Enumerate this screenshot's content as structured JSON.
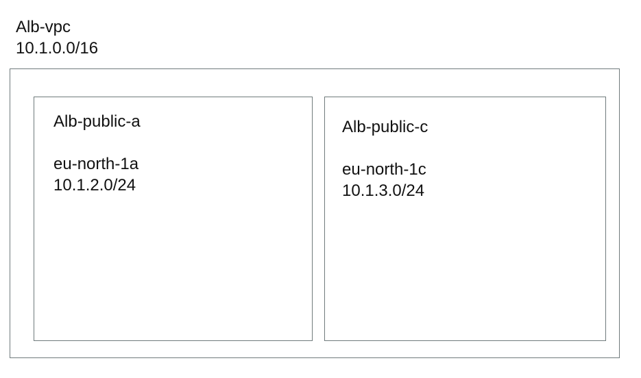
{
  "vpc": {
    "name": "Alb-vpc",
    "cidr": "10.1.0.0/16"
  },
  "subnets": [
    {
      "name": "Alb-public-a",
      "az": "eu-north-1a",
      "cidr": "10.1.2.0/24"
    },
    {
      "name": "Alb-public-c",
      "az": "eu-north-1c",
      "cidr": "10.1.3.0/24"
    }
  ],
  "colors": {
    "border": "#6f7a7b",
    "text": "#111111",
    "background": "#ffffff"
  }
}
